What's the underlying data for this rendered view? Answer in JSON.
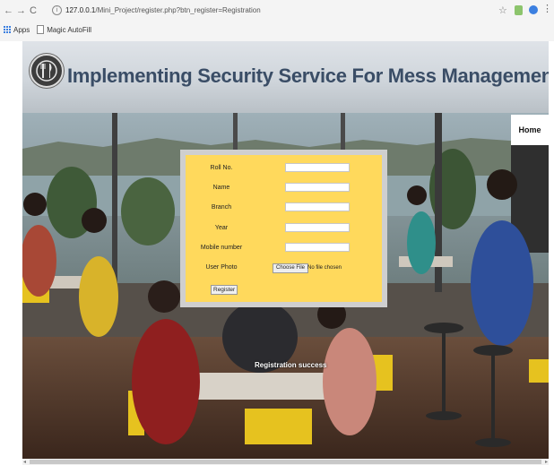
{
  "browser": {
    "nav": {
      "back": "←",
      "forward": "→",
      "reload": "C"
    },
    "url_host": "127.0.0.1",
    "url_path": "/Mini_Project/register.php?btn_register=Registration",
    "bookmarks": [
      {
        "label": "Apps"
      },
      {
        "label": "Magic AutoFill"
      }
    ],
    "icons": {
      "star": "☆",
      "kebab": "⋮"
    }
  },
  "site": {
    "title": "Implementing Security Service For Mess Management System Using PHP.",
    "home_link": "Home"
  },
  "form": {
    "fields": [
      {
        "label": "Roll No.",
        "value": ""
      },
      {
        "label": "Name",
        "value": ""
      },
      {
        "label": "Branch",
        "value": ""
      },
      {
        "label": "Year",
        "value": ""
      },
      {
        "label": "Mobile number",
        "value": ""
      }
    ],
    "photo_label": "User Photo",
    "file_button": "Choose File",
    "file_status": "No file chosen",
    "submit": "Register"
  },
  "status_message": "Registration success",
  "colors": {
    "form_bg": "#ffd95c",
    "title": "#3a4d66"
  }
}
